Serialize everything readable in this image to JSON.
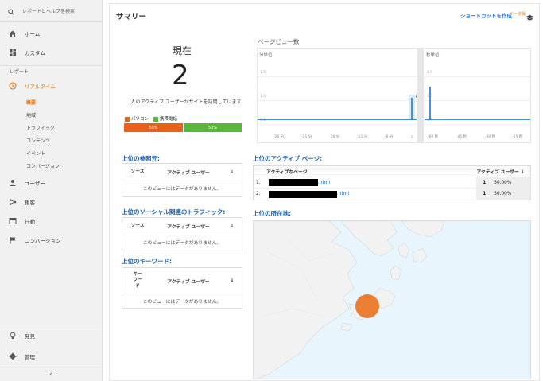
{
  "sidebar": {
    "search_placeholder": "レポートとヘルプを検索",
    "home": "ホーム",
    "custom": "カスタム",
    "reports_section": "レポート",
    "realtime": "リアルタイム",
    "realtime_sub": [
      "概要",
      "地域",
      "トラフィック",
      "コンテンツ",
      "イベント",
      "コンバージョン"
    ],
    "audience": "ユーザー",
    "acquisition": "集客",
    "behavior": "行動",
    "conversions": "コンバージョン",
    "discover": "発見",
    "admin": "管理",
    "collapse": "‹"
  },
  "header": {
    "title": "サマリー",
    "shortcut": "ショートカットを作成",
    "beta": "ベータ版"
  },
  "now": {
    "label": "現在",
    "count": "2",
    "desc": "人のアクティブ ユーザーがサイトを訪問しています",
    "legend_pc": "パソコン",
    "legend_mobile": "携帯電話",
    "pc_pct": "50%",
    "mobile_pct": "50%",
    "pc_fraction": 0.5,
    "colors": {
      "pc": "#e8611a",
      "mobile": "#58b837"
    }
  },
  "pageviews": {
    "title": "ページビュー数",
    "per_minute": "分単位",
    "per_second": "秒単位",
    "y_ticks": [
      "1.5",
      "1.0",
      "0.5"
    ],
    "minute_ticks": [
      "-26 分",
      "-21 分",
      "-16 分",
      "-11 分",
      "-6 分"
    ],
    "second_ticks": [
      "-60 秒",
      "-45 秒",
      "-30 秒",
      "-15 秒"
    ],
    "minute_last_label": "-1"
  },
  "referrers": {
    "title": "上位の参照元:",
    "col1": "ソース",
    "col2": "アクティブ ユーザー",
    "empty": "このビューにはデータがありません。"
  },
  "social": {
    "title": "上位のソーシャル関連のトラフィック:",
    "col1": "ソース",
    "col2": "アクティブ ユーザー",
    "empty": "このビューにはデータがありません。"
  },
  "keywords": {
    "title": "上位のキーワード:",
    "col1": "キーワード",
    "col2": "アクティブ ユーザー",
    "empty": "このビューにはデータがありません。"
  },
  "active_pages": {
    "title": "上位のアクティブ ページ:",
    "col_page": "アクティブなページ",
    "col_users": "アクティブ ユーザー",
    "rows": [
      {
        "idx": "1.",
        "suffix": ".html",
        "count": "1",
        "pct": "50.00%"
      },
      {
        "idx": "2.",
        "suffix": ".html",
        "count": "1",
        "pct": "50.00%"
      }
    ]
  },
  "locations": {
    "title": "上位の所在地:"
  }
}
